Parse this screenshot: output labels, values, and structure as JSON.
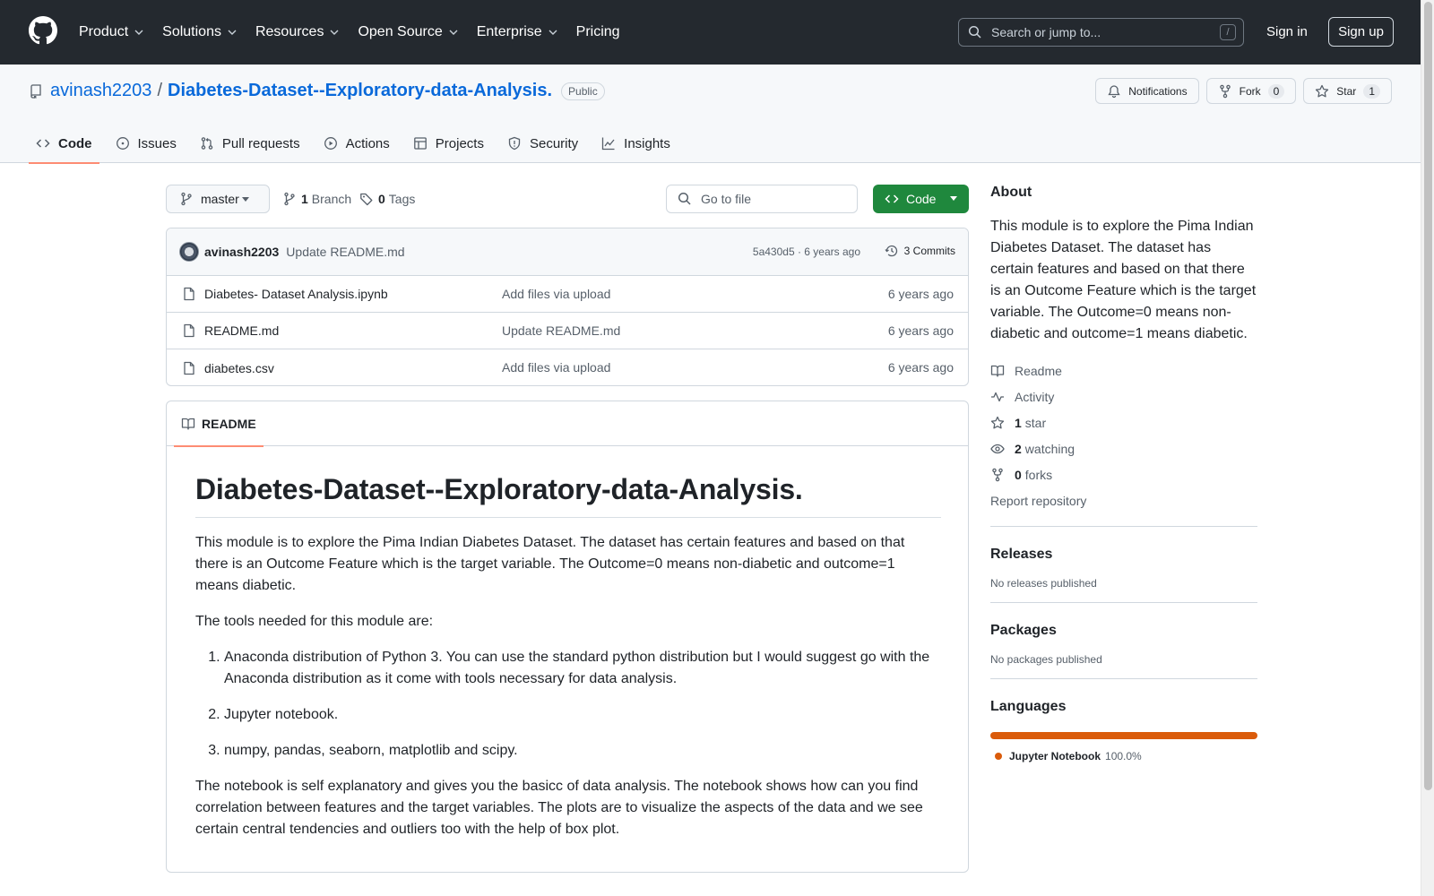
{
  "header": {
    "nav": [
      "Product",
      "Solutions",
      "Resources",
      "Open Source",
      "Enterprise",
      "Pricing"
    ],
    "search_placeholder": "Search or jump to...",
    "search_shortcut": "/",
    "sign_in": "Sign in",
    "sign_up": "Sign up"
  },
  "repo": {
    "owner": "avinash2203",
    "separator": "/",
    "name": "Diabetes-Dataset--Exploratory-data-Analysis.",
    "visibility": "Public",
    "notifications_label": "Notifications",
    "fork_label": "Fork",
    "fork_count": "0",
    "star_label": "Star",
    "star_count": "1",
    "tabs": [
      "Code",
      "Issues",
      "Pull requests",
      "Actions",
      "Projects",
      "Security",
      "Insights"
    ]
  },
  "toolbar": {
    "branch": "master",
    "branch_count": "1",
    "branch_label": "Branch",
    "tag_count": "0",
    "tag_label": "Tags",
    "goto_placeholder": "Go to file",
    "code_label": "Code"
  },
  "commit": {
    "author": "avinash2203",
    "message": "Update README.md",
    "meta": "5a430d5 · 6 years ago",
    "count_label": "3 Commits"
  },
  "files": [
    {
      "name": "Diabetes- Dataset Analysis.ipynb",
      "message": "Add files via upload",
      "time": "6 years ago"
    },
    {
      "name": "README.md",
      "message": "Update README.md",
      "time": "6 years ago"
    },
    {
      "name": "diabetes.csv",
      "message": "Add files via upload",
      "time": "6 years ago"
    }
  ],
  "readme": {
    "tab_label": "README",
    "title": "Diabetes-Dataset--Exploratory-data-Analysis.",
    "intro": "This module is to explore the Pima Indian Diabetes Dataset. The dataset has certain features and based on that there is an Outcome Feature which is the target variable. The Outcome=0 means non-diabetic and outcome=1 means diabetic.",
    "tools_intro": "The tools needed for this module are:",
    "tools": [
      "Anaconda distribution of Python 3. You can use the standard python distribution but I would suggest go with the Anaconda distribution as it come with tools necessary for data analysis.",
      "Jupyter notebook.",
      "numpy, pandas, seaborn, matplotlib and scipy."
    ],
    "closing": "The notebook is self explanatory and gives you the basicc of data analysis. The notebook shows how can you find correlation between features and the target variables. The plots are to visualize the aspects of the data and we see certain central tendencies and outliers too with the help of box plot."
  },
  "sidebar": {
    "about_title": "About",
    "about_text": "This module is to explore the Pima Indian Diabetes Dataset. The dataset has certain features and based on that there is an Outcome Feature which is the target variable. The Outcome=0 means non-diabetic and outcome=1 means diabetic.",
    "readme_label": "Readme",
    "activity_label": "Activity",
    "stars_count": "1",
    "stars_label": "star",
    "watching_count": "2",
    "watching_label": "watching",
    "forks_count": "0",
    "forks_label": "forks",
    "report_label": "Report repository",
    "releases_title": "Releases",
    "releases_text": "No releases published",
    "packages_title": "Packages",
    "packages_text": "No packages published",
    "languages_title": "Languages",
    "language_name": "Jupyter Notebook",
    "language_pct": "100.0%",
    "language_color": "#da5b0b",
    "language_share": 1.0
  }
}
